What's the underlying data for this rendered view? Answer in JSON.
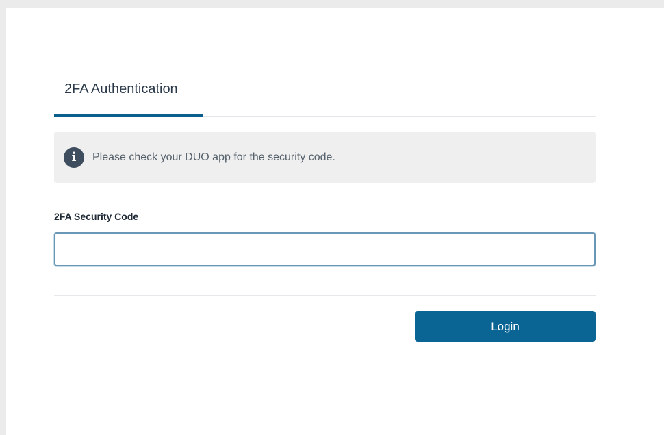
{
  "tabs": {
    "active_label": "2FA Authentication"
  },
  "alert": {
    "icon": "info-icon",
    "icon_glyph": "i",
    "message": "Please check your DUO app for the security code."
  },
  "form": {
    "code_label": "2FA Security Code",
    "code_value": "",
    "code_placeholder": "",
    "login_label": "Login"
  },
  "colors": {
    "accent": "#0b5f8c",
    "button": "#0b6594",
    "alert_bg": "#efefef",
    "icon_bg": "#3f4e5f"
  }
}
